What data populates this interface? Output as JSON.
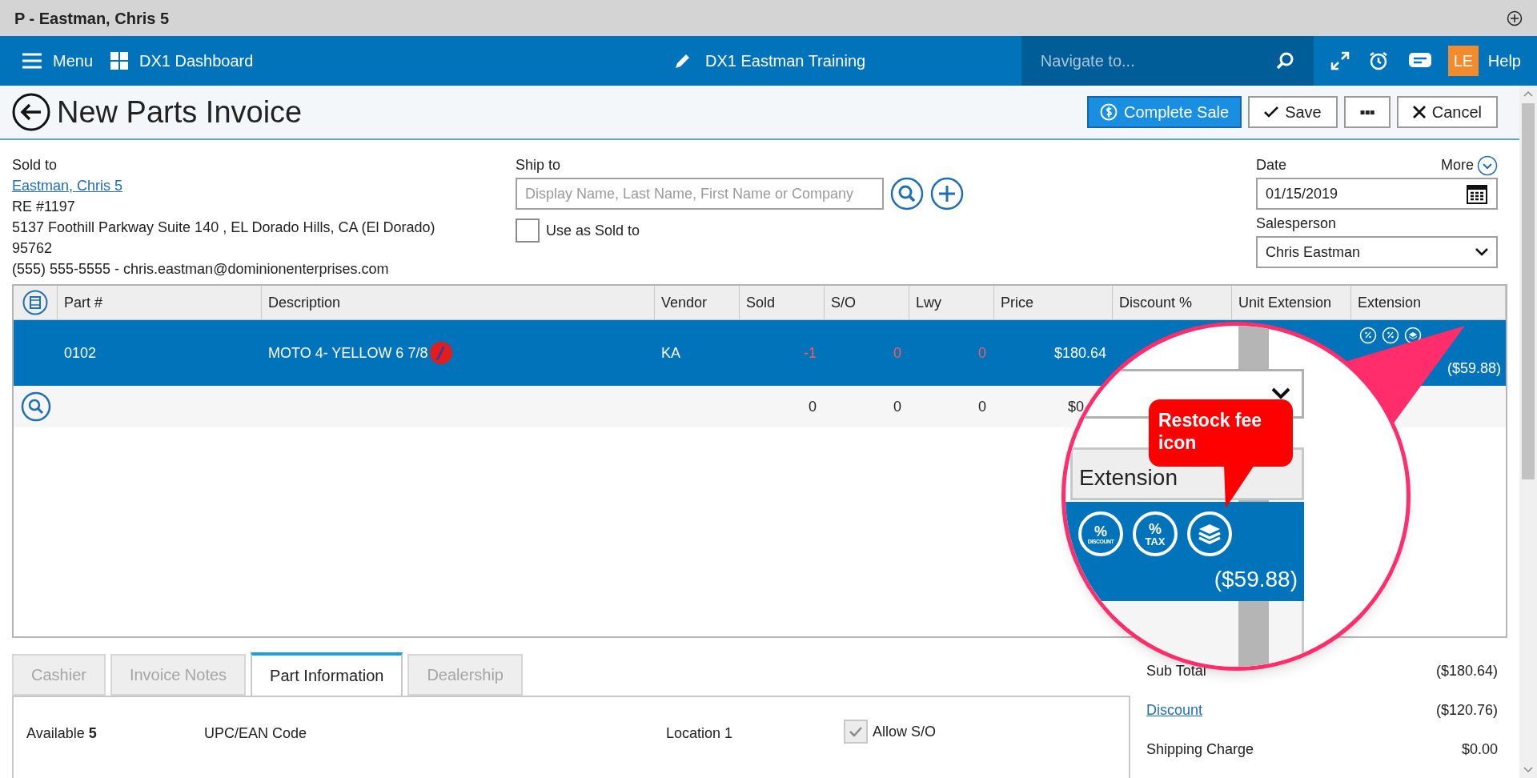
{
  "window": {
    "title": "P - Eastman, Chris 5"
  },
  "nav": {
    "menu": "Menu",
    "dashboard": "DX1 Dashboard",
    "store": "DX1 Eastman Training",
    "search": {
      "placeholder": "Navigate to..."
    },
    "user_initials": "LE",
    "help": "Help"
  },
  "header": {
    "title": "New Parts Invoice",
    "buttons": [
      {
        "kind": "primary",
        "label": "Complete Sale"
      },
      {
        "kind": "save",
        "label": "Save"
      },
      {
        "kind": "more",
        "label": "▪▪▪"
      },
      {
        "kind": "cancel",
        "label": "Cancel"
      }
    ]
  },
  "sold_to": {
    "label": "Sold to",
    "name": "Eastman, Chris 5",
    "lines": [
      "RE #1197",
      "5137 Foothill Parkway Suite 140 , EL Dorado Hills, CA (El Dorado)",
      "95762",
      "(555) 555-5555 - chris.eastman@dominionenterprises.com"
    ]
  },
  "ship_to": {
    "label": "Ship to",
    "placeholder": "Display Name, Last Name, First Name or Company",
    "use_as_sold_to": {
      "label": "Use as Sold to",
      "checked": false
    }
  },
  "date": {
    "label": "Date",
    "value": "01/15/2019",
    "more": "More"
  },
  "salesperson": {
    "label": "Salesperson",
    "value": "Chris Eastman"
  },
  "table": {
    "columns": [
      "Part #",
      "Description",
      "Vendor",
      "Sold",
      "S/O",
      "Lwy",
      "Price",
      "Discount %",
      "Unit Extension",
      "Extension"
    ],
    "rows": [
      {
        "kind": "item",
        "selected": true,
        "part": "0102",
        "description": "MOTO 4- YELLOW 6 7/8",
        "vendor": "KA",
        "sold": "-1",
        "so": "0",
        "lwy": "0",
        "alert": true,
        "price": "$180.64",
        "extension": "($59.88)"
      },
      {
        "kind": "entry",
        "selected": false,
        "sold": "0",
        "so": "0",
        "lwy": "0",
        "alert": false,
        "price": "$0"
      }
    ]
  },
  "magnifier": {
    "header": "Extension",
    "callout": "Restock fee icon",
    "icons": [
      {
        "kind": "discount",
        "symbol": "%",
        "label": "DISCOUNT"
      },
      {
        "kind": "tax",
        "symbol": "%",
        "label": "TAX"
      },
      {
        "kind": "restock"
      }
    ],
    "extension": "($59.88)"
  },
  "tabs": [
    {
      "label": "Cashier",
      "selected": false
    },
    {
      "label": "Invoice Notes",
      "selected": false
    },
    {
      "label": "Part Information",
      "selected": true
    },
    {
      "label": "Dealership",
      "selected": false
    }
  ],
  "part_info": {
    "available_label": "Available",
    "available": "5",
    "upc_label": "UPC/EAN Code",
    "location_label": "Location 1",
    "allow_so": {
      "label": "Allow S/O",
      "checked": true
    }
  },
  "totals": [
    {
      "kind": "text",
      "label": "Sub Total",
      "value": "($180.64)"
    },
    {
      "kind": "link",
      "label": "Discount",
      "value": "($120.76)"
    },
    {
      "kind": "text",
      "label": "Shipping Charge",
      "value": "$0.00"
    }
  ]
}
